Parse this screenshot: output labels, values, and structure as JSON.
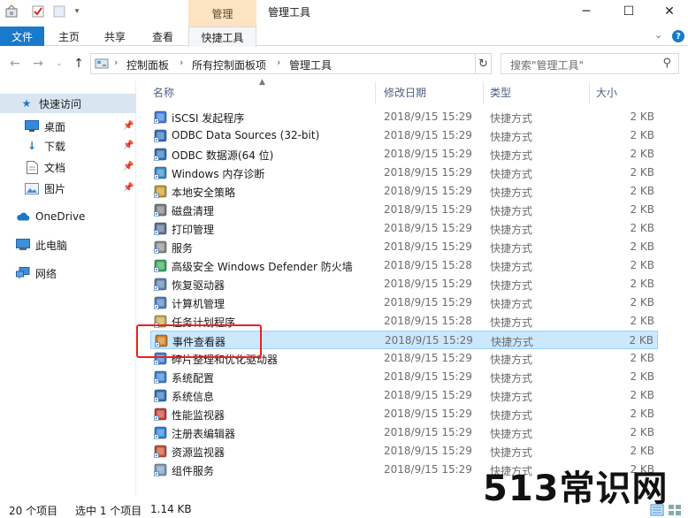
{
  "titlebar": {
    "context_tab": "管理",
    "title": "管理工具",
    "icons": [
      "properties-icon",
      "checklist-icon",
      "new-folder-icon",
      "quick-access-dropdown-icon"
    ],
    "controls": [
      "minimize-icon",
      "maximize-icon",
      "close-icon"
    ]
  },
  "ribbon": {
    "tabs": [
      {
        "label": "文件"
      },
      {
        "label": "主页"
      },
      {
        "label": "共享"
      },
      {
        "label": "查看"
      },
      {
        "label": "快捷工具"
      }
    ],
    "right_icons": [
      "expand-ribbon-icon",
      "help-icon"
    ]
  },
  "address": {
    "breadcrumbs": [
      "控制面板",
      "所有控制面板项",
      "管理工具"
    ],
    "search_placeholder": "搜索\"管理工具\""
  },
  "nav": {
    "quick_access": "快速访问",
    "pinned": [
      {
        "label": "桌面",
        "icon": "desktop-icon"
      },
      {
        "label": "下载",
        "icon": "download-icon"
      },
      {
        "label": "文档",
        "icon": "documents-icon"
      },
      {
        "label": "图片",
        "icon": "pictures-icon"
      }
    ],
    "onedrive": "OneDrive",
    "this_pc": "此电脑",
    "network": "网络"
  },
  "columns": {
    "name": "名称",
    "date": "修改日期",
    "type": "类型",
    "size": "大小"
  },
  "files": [
    {
      "name": "iSCSI 发起程序",
      "date": "2018/9/15 15:29",
      "type": "快捷方式",
      "size": "2 KB",
      "icon": "iscsi-icon"
    },
    {
      "name": "ODBC Data Sources (32-bit)",
      "date": "2018/9/15 15:29",
      "type": "快捷方式",
      "size": "2 KB",
      "icon": "odbc-icon"
    },
    {
      "name": "ODBC 数据源(64 位)",
      "date": "2018/9/15 15:29",
      "type": "快捷方式",
      "size": "2 KB",
      "icon": "odbc-icon"
    },
    {
      "name": "Windows 内存诊断",
      "date": "2018/9/15 15:29",
      "type": "快捷方式",
      "size": "2 KB",
      "icon": "memory-diagnostic-icon"
    },
    {
      "name": "本地安全策略",
      "date": "2018/9/15 15:29",
      "type": "快捷方式",
      "size": "2 KB",
      "icon": "security-policy-icon"
    },
    {
      "name": "磁盘清理",
      "date": "2018/9/15 15:29",
      "type": "快捷方式",
      "size": "2 KB",
      "icon": "disk-cleanup-icon"
    },
    {
      "name": "打印管理",
      "date": "2018/9/15 15:29",
      "type": "快捷方式",
      "size": "2 KB",
      "icon": "printer-icon"
    },
    {
      "name": "服务",
      "date": "2018/9/15 15:29",
      "type": "快捷方式",
      "size": "2 KB",
      "icon": "services-gear-icon"
    },
    {
      "name": "高级安全 Windows Defender 防火墙",
      "date": "2018/9/15 15:28",
      "type": "快捷方式",
      "size": "2 KB",
      "icon": "firewall-icon"
    },
    {
      "name": "恢复驱动器",
      "date": "2018/9/15 15:29",
      "type": "快捷方式",
      "size": "2 KB",
      "icon": "recovery-drive-icon"
    },
    {
      "name": "计算机管理",
      "date": "2018/9/15 15:29",
      "type": "快捷方式",
      "size": "2 KB",
      "icon": "computer-management-icon"
    },
    {
      "name": "任务计划程序",
      "date": "2018/9/15 15:28",
      "type": "快捷方式",
      "size": "2 KB",
      "icon": "task-scheduler-icon"
    },
    {
      "name": "事件查看器",
      "date": "2018/9/15 15:29",
      "type": "快捷方式",
      "size": "2 KB",
      "icon": "event-viewer-icon",
      "selected": true
    },
    {
      "name": "碎片整理和优化驱动器",
      "date": "2018/9/15 15:29",
      "type": "快捷方式",
      "size": "2 KB",
      "icon": "defrag-icon"
    },
    {
      "name": "系统配置",
      "date": "2018/9/15 15:29",
      "type": "快捷方式",
      "size": "2 KB",
      "icon": "system-config-icon"
    },
    {
      "name": "系统信息",
      "date": "2018/9/15 15:29",
      "type": "快捷方式",
      "size": "2 KB",
      "icon": "system-info-icon"
    },
    {
      "name": "性能监视器",
      "date": "2018/9/15 15:29",
      "type": "快捷方式",
      "size": "2 KB",
      "icon": "performance-monitor-icon"
    },
    {
      "name": "注册表编辑器",
      "date": "2018/9/15 15:29",
      "type": "快捷方式",
      "size": "2 KB",
      "icon": "registry-editor-icon"
    },
    {
      "name": "资源监视器",
      "date": "2018/9/15 15:29",
      "type": "快捷方式",
      "size": "2 KB",
      "icon": "resource-monitor-icon"
    },
    {
      "name": "组件服务",
      "date": "2018/9/15 15:29",
      "type": "快捷方式",
      "size": "2 KB",
      "icon": "component-services-icon"
    }
  ],
  "status": {
    "count": "20 个项目",
    "selection": "选中 1 个项目",
    "size": "1.14 KB"
  },
  "watermark": "513常识网",
  "colors": {
    "file_tab": "#1979ca",
    "context_tab": "#fce4c2",
    "selected_row": "#cce8ff",
    "highlight_box": "#e8231f"
  }
}
